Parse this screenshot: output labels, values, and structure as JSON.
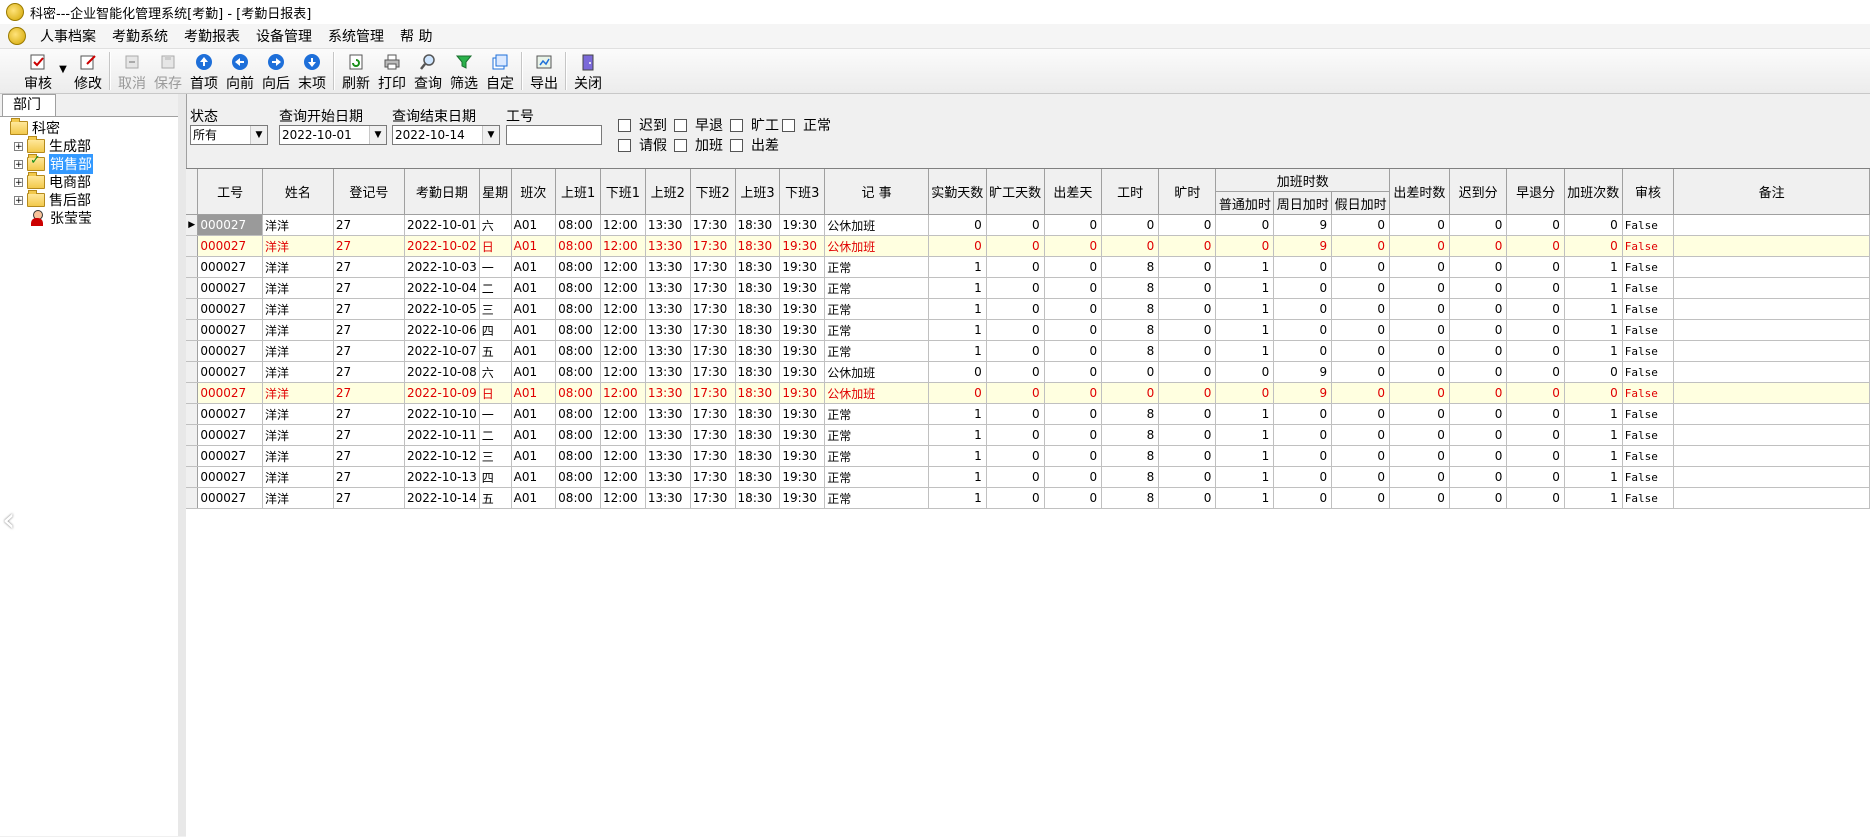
{
  "window": {
    "title": "科密---企业智能化管理系统[考勤] - [考勤日报表]"
  },
  "menu": [
    "人事档案",
    "考勤系统",
    "考勤报表",
    "设备管理",
    "系统管理",
    "帮 助"
  ],
  "toolbar": {
    "audit": "审核",
    "edit": "修改",
    "cancel": "取消",
    "save": "保存",
    "first": "首项",
    "prev": "向前",
    "next": "向后",
    "last": "末项",
    "refresh": "刷新",
    "print": "打印",
    "query": "查询",
    "filter": "筛选",
    "custom": "自定",
    "export": "导出",
    "close": "关闭"
  },
  "left": {
    "tab": "部门",
    "tree": {
      "root": "科密",
      "depts": [
        "生成部",
        "销售部",
        "电商部",
        "售后部"
      ],
      "person": "张莹莹"
    }
  },
  "filter": {
    "status_label": "状态",
    "status_value": "所有",
    "start_label": "查询开始日期",
    "start_value": "2022-10-01",
    "end_label": "查询结束日期",
    "end_value": "2022-10-14",
    "id_label": "工号",
    "id_value": "",
    "checks": [
      "迟到",
      "早退",
      "旷工",
      "正常",
      "请假",
      "加班",
      "出差"
    ]
  },
  "grid": {
    "headers": {
      "id": "工号",
      "name": "姓名",
      "reg": "登记号",
      "date": "考勤日期",
      "week": "星期",
      "shift": "班次",
      "on1": "上班1",
      "off1": "下班1",
      "on2": "上班2",
      "off2": "下班2",
      "on3": "上班3",
      "off3": "下班3",
      "note": "记 事",
      "work_days": "实勤天数",
      "absent_days": "旷工天数",
      "trip_days": "出差天",
      "work_hours": "工时",
      "absent_hours": "旷时",
      "ot_group": "加班时数",
      "ot_normal": "普通加时",
      "ot_weekend": "周日加时",
      "ot_holiday": "假日加时",
      "trip_hours": "出差时数",
      "late_min": "迟到分",
      "early_min": "早退分",
      "ot_count": "加班次数",
      "audit": "审核",
      "remark": "备注"
    },
    "rows": [
      {
        "id": "000027",
        "name": "洋洋",
        "reg": "27",
        "date": "2022-10-01",
        "week": "六",
        "shift": "A01",
        "on1": "08:00",
        "off1": "12:00",
        "on2": "13:30",
        "off2": "17:30",
        "on3": "18:30",
        "off3": "19:30",
        "note": "公休加班",
        "work_days": "0",
        "absent_days": "0",
        "trip_days": "0",
        "work_hours": "0",
        "absent_hours": "0",
        "ot_normal": "0",
        "ot_weekend": "9",
        "ot_holiday": "0",
        "trip_hours": "0",
        "late_min": "0",
        "early_min": "0",
        "ot_count": "0",
        "audit": "False",
        "remark": "",
        "highlight": false,
        "current": true
      },
      {
        "id": "000027",
        "name": "洋洋",
        "reg": "27",
        "date": "2022-10-02",
        "week": "日",
        "shift": "A01",
        "on1": "08:00",
        "off1": "12:00",
        "on2": "13:30",
        "off2": "17:30",
        "on3": "18:30",
        "off3": "19:30",
        "note": "公休加班",
        "work_days": "0",
        "absent_days": "0",
        "trip_days": "0",
        "work_hours": "0",
        "absent_hours": "0",
        "ot_normal": "0",
        "ot_weekend": "9",
        "ot_holiday": "0",
        "trip_hours": "0",
        "late_min": "0",
        "early_min": "0",
        "ot_count": "0",
        "audit": "False",
        "remark": "",
        "highlight": true,
        "current": false
      },
      {
        "id": "000027",
        "name": "洋洋",
        "reg": "27",
        "date": "2022-10-03",
        "week": "一",
        "shift": "A01",
        "on1": "08:00",
        "off1": "12:00",
        "on2": "13:30",
        "off2": "17:30",
        "on3": "18:30",
        "off3": "19:30",
        "note": "正常",
        "work_days": "1",
        "absent_days": "0",
        "trip_days": "0",
        "work_hours": "8",
        "absent_hours": "0",
        "ot_normal": "1",
        "ot_weekend": "0",
        "ot_holiday": "0",
        "trip_hours": "0",
        "late_min": "0",
        "early_min": "0",
        "ot_count": "1",
        "audit": "False",
        "remark": "",
        "highlight": false,
        "current": false
      },
      {
        "id": "000027",
        "name": "洋洋",
        "reg": "27",
        "date": "2022-10-04",
        "week": "二",
        "shift": "A01",
        "on1": "08:00",
        "off1": "12:00",
        "on2": "13:30",
        "off2": "17:30",
        "on3": "18:30",
        "off3": "19:30",
        "note": "正常",
        "work_days": "1",
        "absent_days": "0",
        "trip_days": "0",
        "work_hours": "8",
        "absent_hours": "0",
        "ot_normal": "1",
        "ot_weekend": "0",
        "ot_holiday": "0",
        "trip_hours": "0",
        "late_min": "0",
        "early_min": "0",
        "ot_count": "1",
        "audit": "False",
        "remark": "",
        "highlight": false,
        "current": false
      },
      {
        "id": "000027",
        "name": "洋洋",
        "reg": "27",
        "date": "2022-10-05",
        "week": "三",
        "shift": "A01",
        "on1": "08:00",
        "off1": "12:00",
        "on2": "13:30",
        "off2": "17:30",
        "on3": "18:30",
        "off3": "19:30",
        "note": "正常",
        "work_days": "1",
        "absent_days": "0",
        "trip_days": "0",
        "work_hours": "8",
        "absent_hours": "0",
        "ot_normal": "1",
        "ot_weekend": "0",
        "ot_holiday": "0",
        "trip_hours": "0",
        "late_min": "0",
        "early_min": "0",
        "ot_count": "1",
        "audit": "False",
        "remark": "",
        "highlight": false,
        "current": false
      },
      {
        "id": "000027",
        "name": "洋洋",
        "reg": "27",
        "date": "2022-10-06",
        "week": "四",
        "shift": "A01",
        "on1": "08:00",
        "off1": "12:00",
        "on2": "13:30",
        "off2": "17:30",
        "on3": "18:30",
        "off3": "19:30",
        "note": "正常",
        "work_days": "1",
        "absent_days": "0",
        "trip_days": "0",
        "work_hours": "8",
        "absent_hours": "0",
        "ot_normal": "1",
        "ot_weekend": "0",
        "ot_holiday": "0",
        "trip_hours": "0",
        "late_min": "0",
        "early_min": "0",
        "ot_count": "1",
        "audit": "False",
        "remark": "",
        "highlight": false,
        "current": false
      },
      {
        "id": "000027",
        "name": "洋洋",
        "reg": "27",
        "date": "2022-10-07",
        "week": "五",
        "shift": "A01",
        "on1": "08:00",
        "off1": "12:00",
        "on2": "13:30",
        "off2": "17:30",
        "on3": "18:30",
        "off3": "19:30",
        "note": "正常",
        "work_days": "1",
        "absent_days": "0",
        "trip_days": "0",
        "work_hours": "8",
        "absent_hours": "0",
        "ot_normal": "1",
        "ot_weekend": "0",
        "ot_holiday": "0",
        "trip_hours": "0",
        "late_min": "0",
        "early_min": "0",
        "ot_count": "1",
        "audit": "False",
        "remark": "",
        "highlight": false,
        "current": false
      },
      {
        "id": "000027",
        "name": "洋洋",
        "reg": "27",
        "date": "2022-10-08",
        "week": "六",
        "shift": "A01",
        "on1": "08:00",
        "off1": "12:00",
        "on2": "13:30",
        "off2": "17:30",
        "on3": "18:30",
        "off3": "19:30",
        "note": "公休加班",
        "work_days": "0",
        "absent_days": "0",
        "trip_days": "0",
        "work_hours": "0",
        "absent_hours": "0",
        "ot_normal": "0",
        "ot_weekend": "9",
        "ot_holiday": "0",
        "trip_hours": "0",
        "late_min": "0",
        "early_min": "0",
        "ot_count": "0",
        "audit": "False",
        "remark": "",
        "highlight": false,
        "current": false
      },
      {
        "id": "000027",
        "name": "洋洋",
        "reg": "27",
        "date": "2022-10-09",
        "week": "日",
        "shift": "A01",
        "on1": "08:00",
        "off1": "12:00",
        "on2": "13:30",
        "off2": "17:30",
        "on3": "18:30",
        "off3": "19:30",
        "note": "公休加班",
        "work_days": "0",
        "absent_days": "0",
        "trip_days": "0",
        "work_hours": "0",
        "absent_hours": "0",
        "ot_normal": "0",
        "ot_weekend": "9",
        "ot_holiday": "0",
        "trip_hours": "0",
        "late_min": "0",
        "early_min": "0",
        "ot_count": "0",
        "audit": "False",
        "remark": "",
        "highlight": true,
        "current": false
      },
      {
        "id": "000027",
        "name": "洋洋",
        "reg": "27",
        "date": "2022-10-10",
        "week": "一",
        "shift": "A01",
        "on1": "08:00",
        "off1": "12:00",
        "on2": "13:30",
        "off2": "17:30",
        "on3": "18:30",
        "off3": "19:30",
        "note": "正常",
        "work_days": "1",
        "absent_days": "0",
        "trip_days": "0",
        "work_hours": "8",
        "absent_hours": "0",
        "ot_normal": "1",
        "ot_weekend": "0",
        "ot_holiday": "0",
        "trip_hours": "0",
        "late_min": "0",
        "early_min": "0",
        "ot_count": "1",
        "audit": "False",
        "remark": "",
        "highlight": false,
        "current": false
      },
      {
        "id": "000027",
        "name": "洋洋",
        "reg": "27",
        "date": "2022-10-11",
        "week": "二",
        "shift": "A01",
        "on1": "08:00",
        "off1": "12:00",
        "on2": "13:30",
        "off2": "17:30",
        "on3": "18:30",
        "off3": "19:30",
        "note": "正常",
        "work_days": "1",
        "absent_days": "0",
        "trip_days": "0",
        "work_hours": "8",
        "absent_hours": "0",
        "ot_normal": "1",
        "ot_weekend": "0",
        "ot_holiday": "0",
        "trip_hours": "0",
        "late_min": "0",
        "early_min": "0",
        "ot_count": "1",
        "audit": "False",
        "remark": "",
        "highlight": false,
        "current": false
      },
      {
        "id": "000027",
        "name": "洋洋",
        "reg": "27",
        "date": "2022-10-12",
        "week": "三",
        "shift": "A01",
        "on1": "08:00",
        "off1": "12:00",
        "on2": "13:30",
        "off2": "17:30",
        "on3": "18:30",
        "off3": "19:30",
        "note": "正常",
        "work_days": "1",
        "absent_days": "0",
        "trip_days": "0",
        "work_hours": "8",
        "absent_hours": "0",
        "ot_normal": "1",
        "ot_weekend": "0",
        "ot_holiday": "0",
        "trip_hours": "0",
        "late_min": "0",
        "early_min": "0",
        "ot_count": "1",
        "audit": "False",
        "remark": "",
        "highlight": false,
        "current": false
      },
      {
        "id": "000027",
        "name": "洋洋",
        "reg": "27",
        "date": "2022-10-13",
        "week": "四",
        "shift": "A01",
        "on1": "08:00",
        "off1": "12:00",
        "on2": "13:30",
        "off2": "17:30",
        "on3": "18:30",
        "off3": "19:30",
        "note": "正常",
        "work_days": "1",
        "absent_days": "0",
        "trip_days": "0",
        "work_hours": "8",
        "absent_hours": "0",
        "ot_normal": "1",
        "ot_weekend": "0",
        "ot_holiday": "0",
        "trip_hours": "0",
        "late_min": "0",
        "early_min": "0",
        "ot_count": "1",
        "audit": "False",
        "remark": "",
        "highlight": false,
        "current": false
      },
      {
        "id": "000027",
        "name": "洋洋",
        "reg": "27",
        "date": "2022-10-14",
        "week": "五",
        "shift": "A01",
        "on1": "08:00",
        "off1": "12:00",
        "on2": "13:30",
        "off2": "17:30",
        "on3": "18:30",
        "off3": "19:30",
        "note": "正常",
        "work_days": "1",
        "absent_days": "0",
        "trip_days": "0",
        "work_hours": "8",
        "absent_hours": "0",
        "ot_normal": "1",
        "ot_weekend": "0",
        "ot_holiday": "0",
        "trip_hours": "0",
        "late_min": "0",
        "early_min": "0",
        "ot_count": "1",
        "audit": "False",
        "remark": "",
        "highlight": false,
        "current": false
      }
    ]
  },
  "colors": {
    "highlight_bg": "#ffffe0",
    "highlight_text": "#e00000",
    "selection": "#3399ff"
  }
}
